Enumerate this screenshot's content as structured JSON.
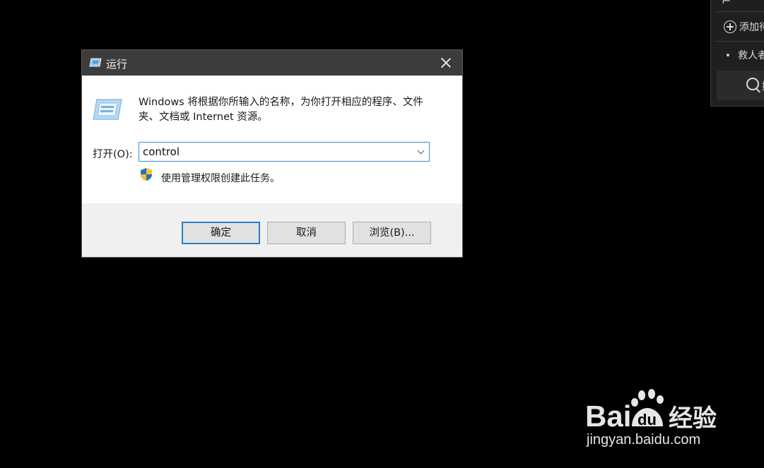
{
  "side_panel": {
    "add_text": "添加待",
    "bullet_text": "救人者",
    "search_text": "搜"
  },
  "dialog": {
    "title": "运行",
    "description": "Windows 将根据你所输入的名称，为你打开相应的程序、文件夹、文档或 Internet 资源。",
    "open_label": "打开(O):",
    "combo_value": "control",
    "admin_text": "使用管理权限创建此任务。",
    "buttons": {
      "ok": "确定",
      "cancel": "取消",
      "browse": "浏览(B)..."
    }
  },
  "watermark": {
    "brand": "Bai 经验",
    "url": "jingyan.baidu.com"
  },
  "colors": {
    "titlebar": "#3c3c3c",
    "focus_blue": "#2e7dc9",
    "footer": "#f0f0f0"
  }
}
